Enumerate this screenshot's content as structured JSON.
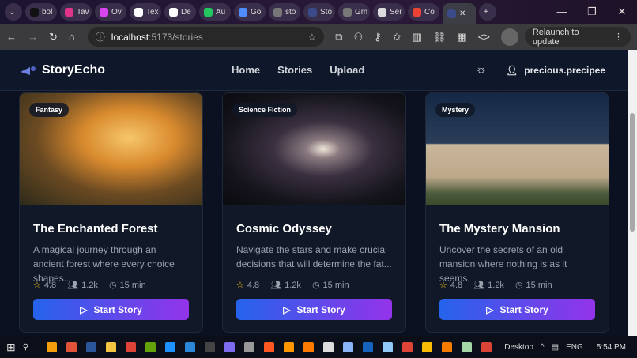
{
  "browser": {
    "tabs": [
      {
        "label": "bol",
        "color": "#111"
      },
      {
        "label": "Tav",
        "color": "#e0338a"
      },
      {
        "label": "Ov",
        "color": "#d946ef"
      },
      {
        "label": "Tex",
        "color": "#fff"
      },
      {
        "label": "De",
        "color": "#fff"
      },
      {
        "label": "Au",
        "color": "#22c55e"
      },
      {
        "label": "Go",
        "color": "#4f8cff"
      },
      {
        "label": "sto",
        "color": "#777"
      },
      {
        "label": "Sto",
        "color": "#3b4b8a"
      },
      {
        "label": "Gm",
        "color": "#777"
      },
      {
        "label": "Ser",
        "color": "#ddd"
      },
      {
        "label": "Co",
        "color": "#ea4335"
      }
    ],
    "active_tab_close": "✕",
    "new_tab": "+",
    "url_host": "localhost",
    "url_path": ":5173/stories",
    "relaunch": "Relaunch to update"
  },
  "app": {
    "brand": "StoryEcho",
    "nav": [
      "Home",
      "Stories",
      "Upload"
    ],
    "username": "precious.precipee",
    "start_label": "Start Story",
    "stories": [
      {
        "genre": "Fantasy",
        "title": "The Enchanted Forest",
        "description": "A magical journey through an ancient forest where every choice shapes...",
        "rating": "4.8",
        "readers": "1.2k",
        "duration": "15 min"
      },
      {
        "genre": "Science Fiction",
        "title": "Cosmic Odyssey",
        "description": "Navigate the stars and make crucial decisions that will determine the fat...",
        "rating": "4.8",
        "readers": "1.2k",
        "duration": "15 min"
      },
      {
        "genre": "Mystery",
        "title": "The Mystery Mansion",
        "description": "Uncover the secrets of an old mansion where nothing is as it seems.",
        "rating": "4.8",
        "readers": "1.2k",
        "duration": "15 min"
      }
    ]
  },
  "taskbar": {
    "desktop": "Desktop",
    "lang": "ENG",
    "time": "5:54 PM"
  }
}
